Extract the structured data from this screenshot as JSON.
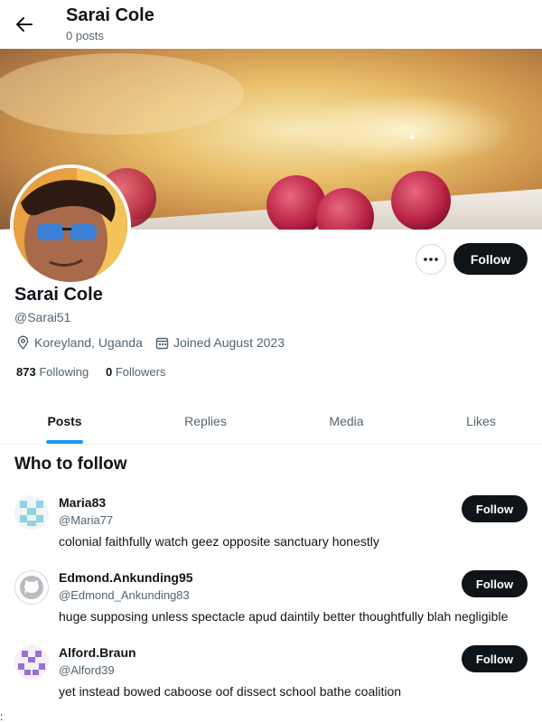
{
  "header": {
    "name": "Sarai Cole",
    "post_count": "0 posts"
  },
  "profile": {
    "name": "Sarai Cole",
    "handle": "@Sarai51",
    "location": "Koreyland, Uganda",
    "joined": "Joined August 2023",
    "following_count": "873",
    "following_label": "Following",
    "followers_count": "0",
    "followers_label": "Followers",
    "follow_label": "Follow"
  },
  "tabs": [
    {
      "label": "Posts",
      "active": true
    },
    {
      "label": "Replies",
      "active": false
    },
    {
      "label": "Media",
      "active": false
    },
    {
      "label": "Likes",
      "active": false
    }
  ],
  "who_to_follow": {
    "title": "Who to follow",
    "suggestions": [
      {
        "name": "Maria83",
        "handle": "@Maria77",
        "bio": "colonial faithfully watch geez opposite sanctuary honestly",
        "follow_label": "Follow"
      },
      {
        "name": "Edmond.Ankunding95",
        "handle": "@Edmond_Ankunding83",
        "bio": "huge supposing unless spectacle apud daintily better thoughtfully blah negligible",
        "follow_label": "Follow"
      },
      {
        "name": "Alford.Braun",
        "handle": "@Alford39",
        "bio": "yet instead bowed caboose oof dissect school bathe coalition",
        "follow_label": "Follow"
      }
    ]
  },
  "stray_char": ":",
  "colors": {
    "accent": "#1d9bf0",
    "text": "#0f1419",
    "secondary": "#536471"
  },
  "icons": [
    "back-arrow-icon",
    "more-icon",
    "location-icon",
    "calendar-icon"
  ]
}
